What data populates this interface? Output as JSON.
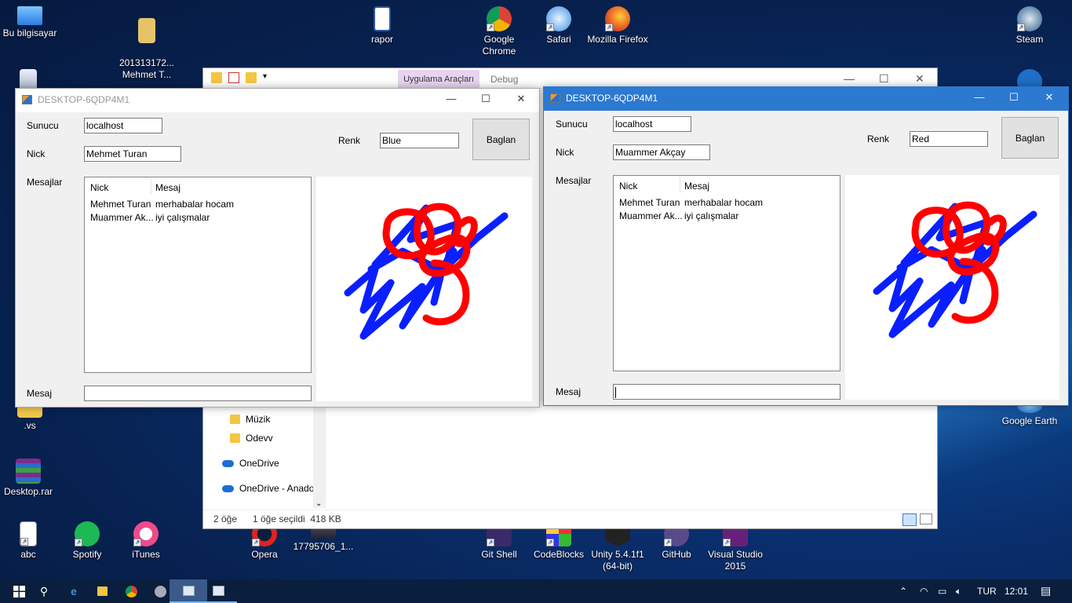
{
  "desktop": {
    "icons_top": [
      {
        "label": "Bu bilgisayar"
      },
      {
        "label": "201313172...\nMehmet T..."
      },
      {
        "label": "rapor"
      },
      {
        "label": "Google Chrome"
      },
      {
        "label": "Safari"
      },
      {
        "label": "Mozilla Firefox"
      },
      {
        "label": "Steam"
      }
    ],
    "icons_left": [
      {
        "label": ".vs"
      },
      {
        "label": "Desktop.rar"
      }
    ],
    "icons_bottom": [
      {
        "label": "abc"
      },
      {
        "label": "Spotify"
      },
      {
        "label": "iTunes"
      },
      {
        "label": "Opera"
      },
      {
        "label": "17795706_1..."
      },
      {
        "label": "Git Shell"
      },
      {
        "label": "CodeBlocks"
      },
      {
        "label": "Unity 5.4.1f1 (64-bit)"
      },
      {
        "label": "GitHub"
      },
      {
        "label": "Visual Studio 2015"
      }
    ],
    "icon_right_google_earth": "Google Earth"
  },
  "explorer": {
    "tab_tools": "Uygulama Araçları",
    "tab_debug": "Debug",
    "nav": [
      "Müzik",
      "Odevv",
      "OneDrive",
      "OneDrive - Anado"
    ],
    "status_count": "2 öğe",
    "status_selected": "1 öğe seçildi  418 KB"
  },
  "form1": {
    "title": "DESKTOP-6QDP4M1",
    "label_server": "Sunucu",
    "server": "localhost",
    "label_nick": "Nick",
    "nick": "Mehmet Turan",
    "label_color": "Renk",
    "color": "Blue",
    "connect_label": "Baglan",
    "label_messages": "Mesajlar",
    "columns": [
      "Nick",
      "Mesaj"
    ],
    "rows": [
      {
        "nick": "Mehmet Turan",
        "msg": "merhabalar hocam"
      },
      {
        "nick": "Muammer Ak...",
        "msg": "iyi çalışmalar"
      }
    ],
    "label_message": "Mesaj",
    "message": ""
  },
  "form2": {
    "title": "DESKTOP-6QDP4M1",
    "label_server": "Sunucu",
    "server": "localhost",
    "label_nick": "Nick",
    "nick": "Muammer Akçay",
    "label_color": "Renk",
    "color": "Red",
    "connect_label": "Baglan",
    "label_messages": "Mesajlar",
    "columns": [
      "Nick",
      "Mesaj"
    ],
    "rows": [
      {
        "nick": "Mehmet Turan",
        "msg": "merhabalar hocam"
      },
      {
        "nick": "Muammer Ak...",
        "msg": "iyi çalışmalar"
      }
    ],
    "label_message": "Mesaj",
    "message": ""
  },
  "drawing_colors": {
    "blue": "#0a1fff",
    "red": "#ff0000"
  },
  "taskbar": {
    "language": "TUR",
    "time": "12:01"
  }
}
